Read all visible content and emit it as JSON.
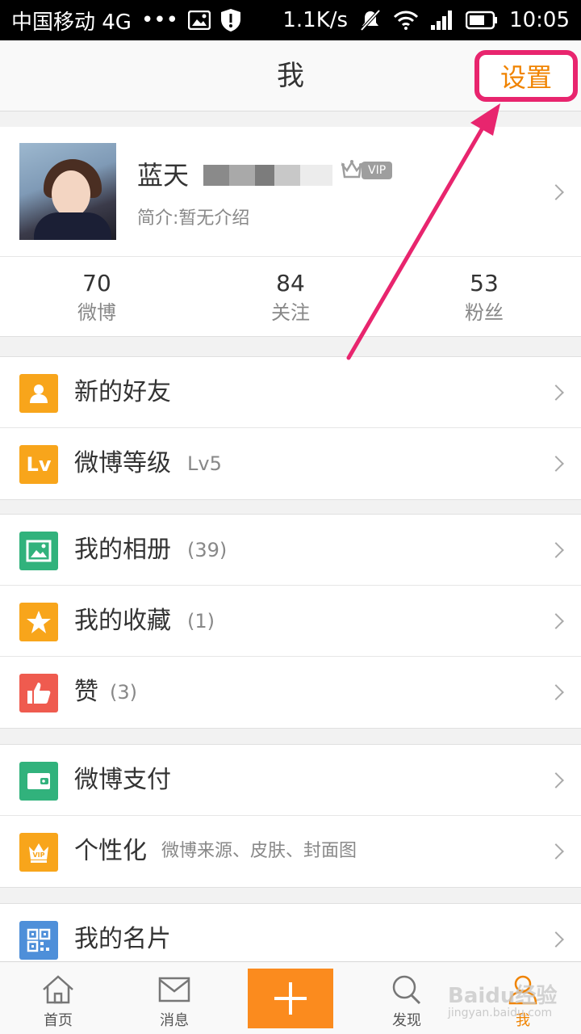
{
  "status_bar": {
    "carrier": "中国移动 4G",
    "dots": "•••",
    "speed": "1.1K/s",
    "time": "10:05"
  },
  "header": {
    "title": "我",
    "settings_label": "设置"
  },
  "profile": {
    "name": "蓝天",
    "vip_label": "VIP",
    "bio": "简介:暂无介绍"
  },
  "stats": [
    {
      "value": "70",
      "label": "微博"
    },
    {
      "value": "84",
      "label": "关注"
    },
    {
      "value": "53",
      "label": "粉丝"
    }
  ],
  "menu": {
    "new_friends": {
      "label": "新的好友"
    },
    "level": {
      "label": "微博等级",
      "sub": "Lv5",
      "icon_text": "Lv"
    },
    "album": {
      "label": "我的相册",
      "sub": "(39)"
    },
    "favorites": {
      "label": "我的收藏",
      "sub": "(1)"
    },
    "likes": {
      "label": "赞",
      "sub": "(3)"
    },
    "pay": {
      "label": "微博支付"
    },
    "personalize": {
      "label": "个性化",
      "sub": "微博来源、皮肤、封面图"
    },
    "card": {
      "label": "我的名片"
    }
  },
  "tabbar": {
    "home": "首页",
    "messages": "消息",
    "discover": "发现",
    "me": "我"
  },
  "watermark": {
    "brand": "Baidu经验",
    "url": "jingyan.baidu.com"
  },
  "colors": {
    "accent": "#f08300",
    "annotation": "#e8256e",
    "orange_icon": "#f8a51b",
    "green_icon": "#31b27c",
    "red_icon": "#ef5b4f",
    "blue_icon": "#4e8fd9"
  }
}
